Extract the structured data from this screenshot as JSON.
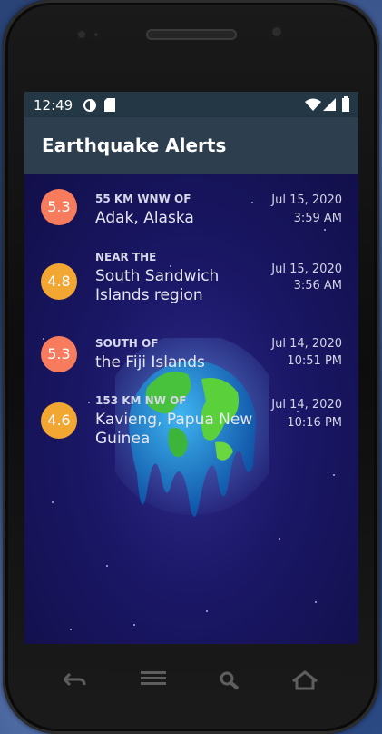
{
  "status_bar": {
    "time": "12:49"
  },
  "app": {
    "title": "Earthquake Alerts"
  },
  "colors": {
    "mag_high": "#f77c5d",
    "mag_mid": "#f3a733",
    "appbar": "#2d3e4f",
    "statusbar": "#243745"
  },
  "earthquakes": [
    {
      "magnitude": "5.3",
      "offset": "55 KM WNW OF",
      "location": "Adak, Alaska",
      "date": "Jul 15, 2020",
      "time": "3:59 AM"
    },
    {
      "magnitude": "4.8",
      "offset": "NEAR THE",
      "location": "South Sandwich Islands region",
      "date": "Jul 15, 2020",
      "time": "3:56 AM"
    },
    {
      "magnitude": "5.3",
      "offset": "SOUTH OF",
      "location": "the Fiji Islands",
      "date": "Jul 14, 2020",
      "time": "10:51 PM"
    },
    {
      "magnitude": "4.6",
      "offset": "153 KM NW OF",
      "location": "Kavieng, Papua New Guinea",
      "date": "Jul 14, 2020",
      "time": "10:16 PM"
    }
  ],
  "nav_icons": [
    "back-icon",
    "menu-icon",
    "search-icon",
    "home-icon"
  ]
}
